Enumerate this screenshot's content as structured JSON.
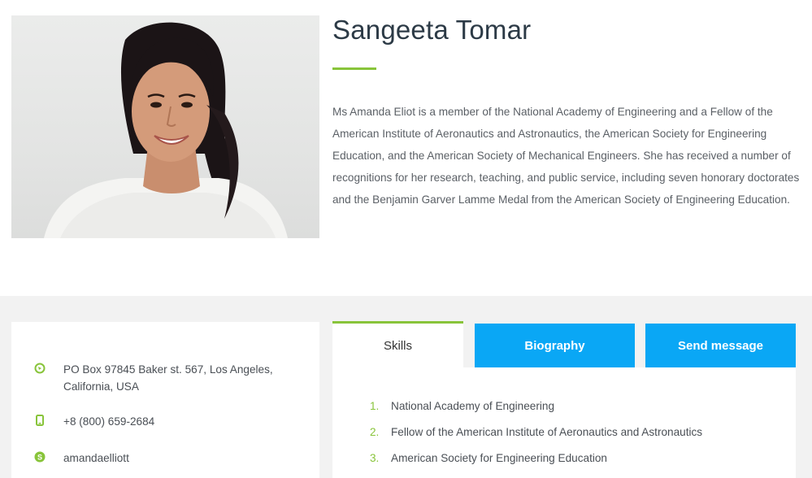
{
  "profile": {
    "name": "Sangeeta Tomar",
    "bio": "Ms Amanda Eliot is a member of the National Academy of Engineering and a Fellow of the American Institute of Aeronautics and Astronautics, the American Society for Engineering Education, and the American Society of Mechanical Engineers. She has received a number of recognitions for her research, teaching, and public service, including seven honorary doctorates and the Benjamin Garver Lamme Medal from the American Society of Engineering Education.",
    "photo_icon": "profile-photo"
  },
  "contact": {
    "address": "PO Box 97845 Baker st. 567, Los Angeles, California, USA",
    "phone": "+8 (800) 659-2684",
    "skype": "amandaelliott",
    "icons": [
      "location-icon",
      "phone-icon",
      "skype-icon"
    ]
  },
  "tabs": {
    "skills": "Skills",
    "biography": "Biography",
    "send_message": "Send message"
  },
  "skills": [
    {
      "num": "1.",
      "label": "National Academy of Engineering"
    },
    {
      "num": "2.",
      "label": "Fellow of the American Institute of Aeronautics and Astronautics"
    },
    {
      "num": "3.",
      "label": "American Society for Engineering Education"
    }
  ],
  "colors": {
    "accent_green": "#88c43a",
    "button_blue": "#0aa7f5",
    "section_bg": "#f2f2f2",
    "heading": "#2c3a46"
  }
}
